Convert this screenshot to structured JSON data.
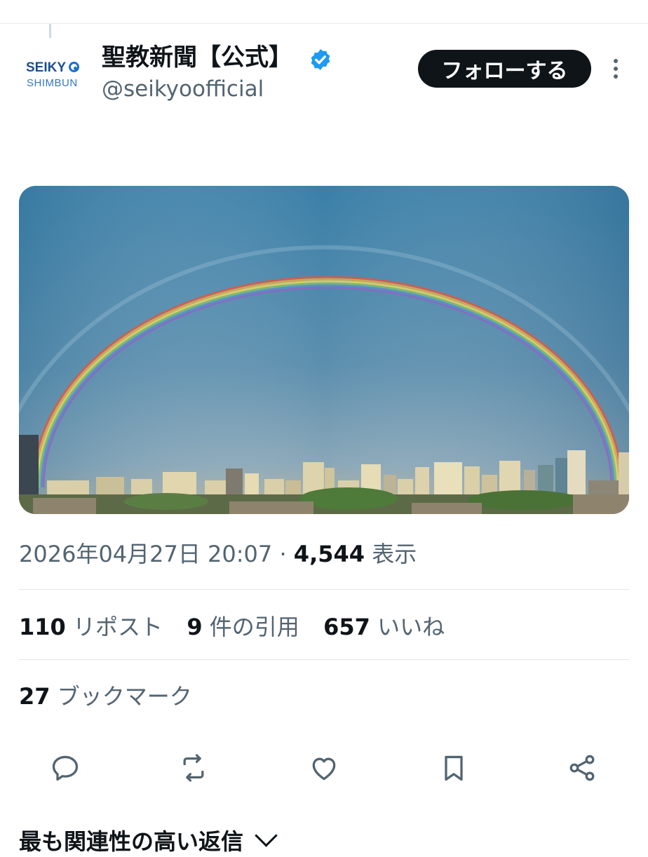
{
  "tweet": {
    "author": {
      "display_name": "聖教新聞【公式】",
      "handle": "@seikyoofficial",
      "avatar_logo": {
        "line1": "SEIKY",
        "line2": "SHIMBUN"
      },
      "verified_color": "#1d9bf0"
    },
    "follow_label": "フォローする",
    "timestamp": "2026年04月27日 20:07",
    "separator": "·",
    "views_count": "4,544",
    "views_label": "表示",
    "stats": {
      "reposts_count": "110",
      "reposts_label": "リポスト",
      "quotes_count": "9",
      "quotes_label": "件の引用",
      "likes_count": "657",
      "likes_label": "いいね",
      "bookmarks_count": "27",
      "bookmarks_label": "ブックマーク"
    },
    "actions": [
      "reply-icon",
      "repost-icon",
      "like-icon",
      "bookmark-icon",
      "share-icon"
    ]
  },
  "replies_heading": "最も関連性の高い返信",
  "colors": {
    "text_primary": "#0f1419",
    "text_secondary": "#536471",
    "accent": "#1d9bf0"
  }
}
